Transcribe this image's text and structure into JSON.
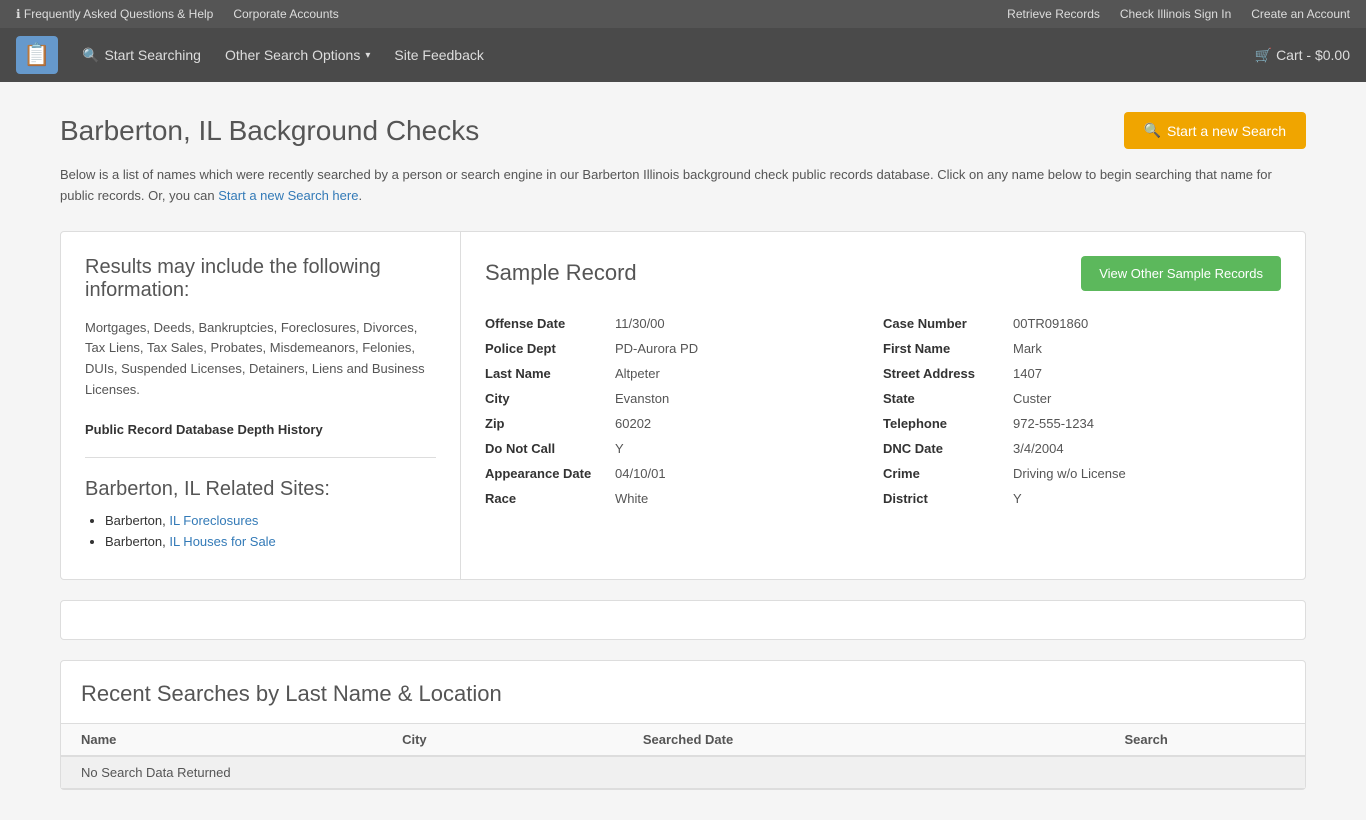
{
  "topbar": {
    "left": {
      "info_label": "ℹ Frequently Asked Questions & Help",
      "corporate": "Corporate Accounts"
    },
    "right": {
      "retrieve": "Retrieve Records",
      "signin": "Check Illinois Sign In",
      "create": "Create an Account"
    }
  },
  "navbar": {
    "logo_icon": "📋",
    "start_searching": "Start Searching",
    "other_search_options": "Other Search Options",
    "site_feedback": "Site Feedback",
    "cart": "Cart - $0.00"
  },
  "page": {
    "title": "Barberton, IL Background Checks",
    "new_search_btn": "Start a new Search",
    "description": "Below is a list of names which were recently searched by a person or search engine in our Barberton Illinois background check public records database. Click on any name below to begin searching that name for public records. Or, you can Start a new Search here.",
    "description_link": "Start a new Search here"
  },
  "left_panel": {
    "results_heading": "Results may include the following information:",
    "results_text": "Mortgages, Deeds, Bankruptcies, Foreclosures, Divorces, Tax Liens, Tax Sales, Probates, Misdemeanors, Felonies, DUIs, Suspended Licenses, Detainers, Liens and Business Licenses.",
    "depth_history_link": "Public Record Database Depth History",
    "related_sites_heading": "Barberton, IL Related Sites:",
    "related_sites": [
      {
        "label": "Barberton, IL Foreclosures",
        "link_text": "IL Foreclosures"
      },
      {
        "label": "Barberton, IL Houses for Sale",
        "link_text": "IL Houses for Sale"
      }
    ]
  },
  "sample_record": {
    "title": "Sample Record",
    "view_btn": "View Other Sample Records",
    "fields_left": [
      {
        "label": "Offense Date",
        "value": "11/30/00"
      },
      {
        "label": "Police Dept",
        "value": "PD-Aurora PD"
      },
      {
        "label": "Last Name",
        "value": "Altpeter"
      },
      {
        "label": "City",
        "value": "Evanston"
      },
      {
        "label": "Zip",
        "value": "60202"
      },
      {
        "label": "Do Not Call",
        "value": "Y"
      },
      {
        "label": "Appearance Date",
        "value": "04/10/01"
      },
      {
        "label": "Race",
        "value": "White"
      }
    ],
    "fields_right": [
      {
        "label": "Case Number",
        "value": "00TR091860"
      },
      {
        "label": "First Name",
        "value": "Mark"
      },
      {
        "label": "Street Address",
        "value": "1407"
      },
      {
        "label": "State",
        "value": "Custer"
      },
      {
        "label": "Telephone",
        "value": "972-555-1234"
      },
      {
        "label": "DNC Date",
        "value": "3/4/2004"
      },
      {
        "label": "Crime",
        "value": "Driving w/o License"
      },
      {
        "label": "District",
        "value": "Y"
      }
    ]
  },
  "recent_searches": {
    "title": "Recent Searches by Last Name & Location",
    "columns": [
      "Name",
      "City",
      "Searched Date",
      "Search"
    ],
    "no_data": "No Search Data Returned"
  }
}
